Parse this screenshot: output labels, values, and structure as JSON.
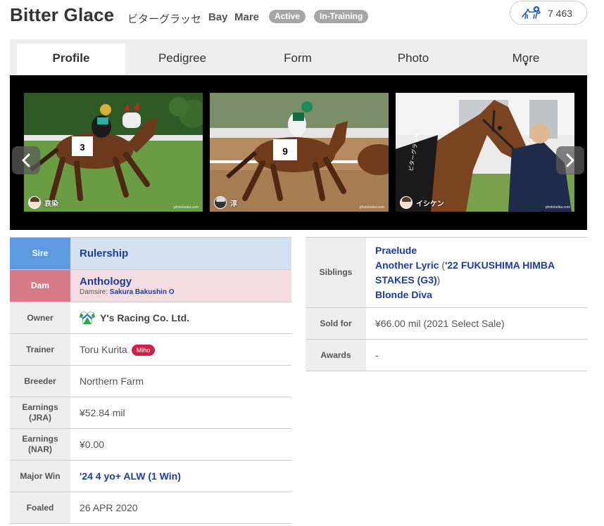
{
  "header": {
    "name": "Bitter Glace",
    "kana": "ビターグラッセ",
    "color": "Bay",
    "sex": "Mare",
    "badge_active": "Active",
    "badge_training": "In-Training",
    "fav_count": "7 463"
  },
  "tabs": [
    {
      "label": "Profile",
      "selected": true
    },
    {
      "label": "Pedigree"
    },
    {
      "label": "Form"
    },
    {
      "label": "Photo"
    },
    {
      "label": "More"
    }
  ],
  "tab_more_arrow": "▼",
  "gallery": {
    "photos": [
      {
        "credit": "哀染",
        "watermark": "photokeiba.com",
        "bib": "3"
      },
      {
        "credit": "淳",
        "watermark": "photokeiba.com",
        "bib": "9"
      },
      {
        "credit": "イシケン",
        "watermark": "photokeiba.com",
        "bib": ""
      }
    ]
  },
  "profile": {
    "sire_label": "Sire",
    "sire": "Rulership",
    "dam_label": "Dam",
    "dam": "Anthology",
    "damsire_label": "Damsire:",
    "damsire": "Sakura Bakushin O",
    "owner_label": "Owner",
    "owner": "Y's Racing Co. Ltd.",
    "trainer_label": "Trainer",
    "trainer": "Toru Kurita",
    "trainer_badge": "Miho",
    "breeder_label": "Breeder",
    "breeder": "Northern Farm",
    "earnings_jra_label": "Earnings (JRA)",
    "earnings_jra": "¥52.84 mil",
    "earnings_nar_label": "Earnings (NAR)",
    "earnings_nar": "¥0.00",
    "major_win_label": "Major Win",
    "major_win": "'24 4 yo+ ALW (1 Win)",
    "foaled_label": "Foaled",
    "foaled": "26 APR 2020"
  },
  "extra": {
    "siblings_label": "Siblings",
    "siblings": {
      "s1": "Praelude",
      "s2": "Another Lyric",
      "s2_open": " (",
      "s2_race": "'22 FUKUSHIMA HIMBA STAKES (G3)",
      "s2_close": ")",
      "s3": "Blonde Diva"
    },
    "sold_label": "Sold for",
    "sold": "¥66.00 mil (2021 Select Sale)",
    "awards_label": "Awards",
    "awards": "-"
  },
  "colors": {
    "sire_header": "#5c9be0",
    "sire_cell": "#d3e1f0",
    "dam_header": "#d67a86",
    "dam_cell": "#f4dde1",
    "link": "#1e3c9a",
    "miho_badge": "#d11f4a",
    "status_badge": "#a6a6a6"
  },
  "icons": [
    "horse-favorite-icon",
    "chevron-left-icon",
    "chevron-right-icon",
    "owner-silks-icon",
    "photographer-avatar-icon"
  ]
}
